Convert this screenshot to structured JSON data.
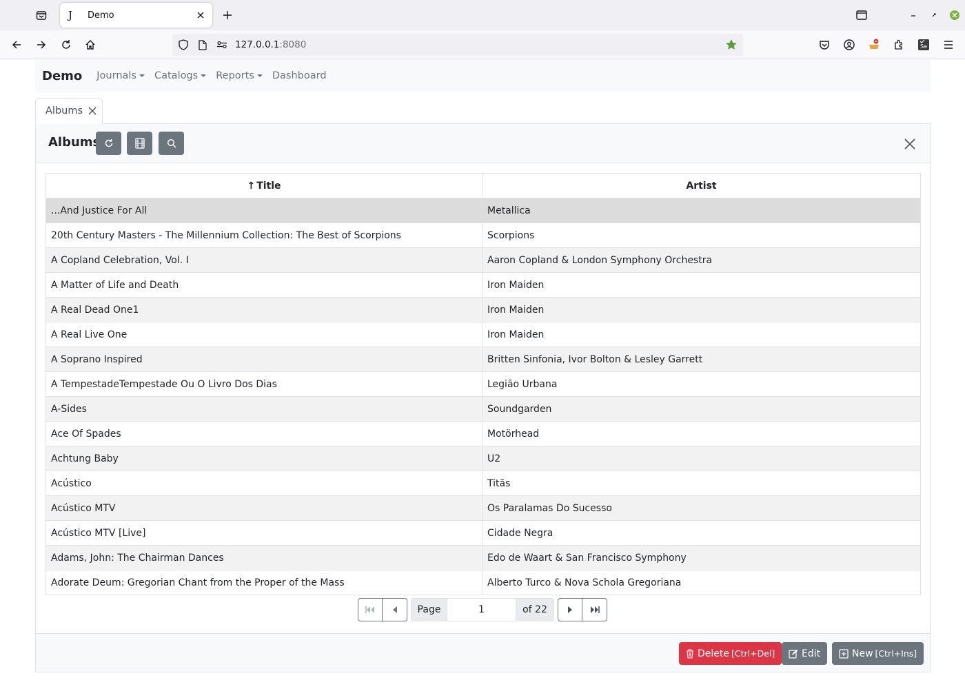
{
  "browser": {
    "tab_favicon": "J",
    "tab_title": "Demo",
    "url_host": "127.0.0.1",
    "url_port": ":8080"
  },
  "app": {
    "brand": "Demo",
    "menu": [
      {
        "label": "Journals",
        "dropdown": true
      },
      {
        "label": "Catalogs",
        "dropdown": true
      },
      {
        "label": "Reports",
        "dropdown": true
      },
      {
        "label": "Dashboard",
        "dropdown": false
      }
    ],
    "doc_tab": "Albums",
    "panel_title": "Albums",
    "columns": [
      {
        "label": "Title",
        "sort": "↑"
      },
      {
        "label": "Artist"
      }
    ],
    "rows": [
      {
        "title": "...And Justice For All",
        "artist": "Metallica"
      },
      {
        "title": "20th Century Masters - The Millennium Collection: The Best of Scorpions",
        "artist": "Scorpions"
      },
      {
        "title": "A Copland Celebration, Vol. I",
        "artist": "Aaron Copland & London Symphony Orchestra"
      },
      {
        "title": "A Matter of Life and Death",
        "artist": "Iron Maiden"
      },
      {
        "title": "A Real Dead One1",
        "artist": "Iron Maiden"
      },
      {
        "title": "A Real Live One",
        "artist": "Iron Maiden"
      },
      {
        "title": "A Soprano Inspired",
        "artist": "Britten Sinfonia, Ivor Bolton & Lesley Garrett"
      },
      {
        "title": "A TempestadeTempestade Ou O Livro Dos Dias",
        "artist": "Legião Urbana"
      },
      {
        "title": "A-Sides",
        "artist": "Soundgarden"
      },
      {
        "title": "Ace Of Spades",
        "artist": "Motörhead"
      },
      {
        "title": "Achtung Baby",
        "artist": "U2"
      },
      {
        "title": "Acústico",
        "artist": "Titãs"
      },
      {
        "title": "Acústico MTV",
        "artist": "Os Paralamas Do Sucesso"
      },
      {
        "title": "Acústico MTV [Live]",
        "artist": "Cidade Negra"
      },
      {
        "title": "Adams, John: The Chairman Dances",
        "artist": "Edo de Waart & San Francisco Symphony"
      },
      {
        "title": "Adorate Deum: Gregorian Chant from the Proper of the Mass",
        "artist": "Alberto Turco & Nova Schola Gregoriana"
      }
    ],
    "selected_row": 0,
    "pager": {
      "page_label": "Page",
      "page_value": "1",
      "of_label": "of 22"
    },
    "footer": {
      "delete_label": "Delete",
      "delete_hint": "[Ctrl+Del]",
      "edit_label": "Edit",
      "new_label": "New",
      "new_hint": "[Ctrl+Ins]"
    },
    "colors": {
      "danger": "#dc3545",
      "secondary": "#6c757d",
      "bookmark_star": "#5a9b3a"
    }
  }
}
